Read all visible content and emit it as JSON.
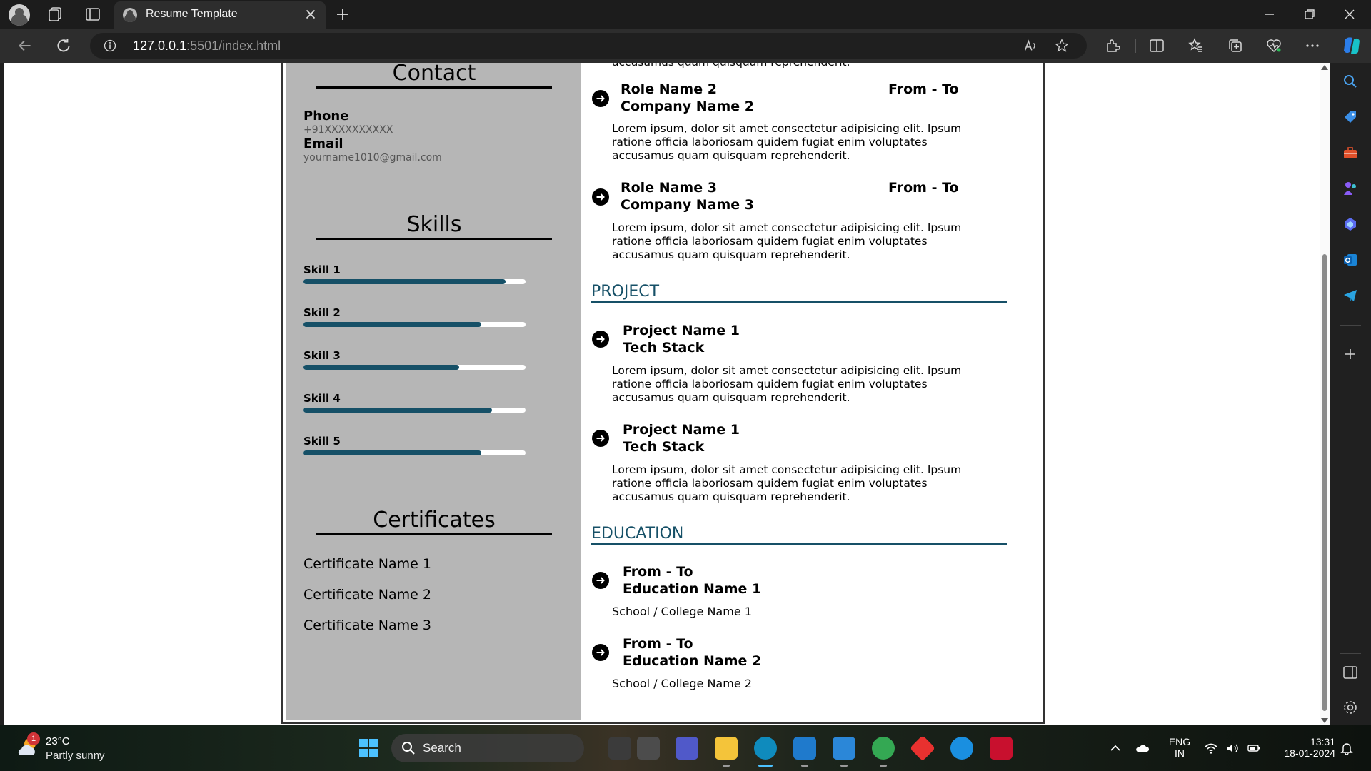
{
  "browser": {
    "tab_title": "Resume Template",
    "url_host": "127.0.0.1",
    "url_rest": ":5501/index.html"
  },
  "resume": {
    "truncated_text": "accusamus quam quisquam reprehenderit.",
    "contact": {
      "heading": "Contact",
      "phone_label": "Phone",
      "phone_value": "+91XXXXXXXXXX",
      "email_label": "Email",
      "email_value": "yourname1010@gmail.com"
    },
    "skills": {
      "heading": "Skills",
      "items": [
        {
          "name": "Skill 1",
          "level": 0.91
        },
        {
          "name": "Skill 2",
          "level": 0.8
        },
        {
          "name": "Skill 3",
          "level": 0.7
        },
        {
          "name": "Skill 4",
          "level": 0.85
        },
        {
          "name": "Skill 5",
          "level": 0.8
        }
      ]
    },
    "certificates": {
      "heading": "Certificates",
      "items": [
        "Certificate Name 1",
        "Certificate Name 2",
        "Certificate Name 3"
      ]
    },
    "experience": [
      {
        "role": "Role Name 2",
        "company": "Company Name 2",
        "period": "From - To",
        "description": "Lorem ipsum, dolor sit amet consectetur adipisicing elit. Ipsum ratione officia laboriosam quidem fugiat enim voluptates accusamus quam quisquam reprehenderit."
      },
      {
        "role": "Role Name 3",
        "company": "Company Name 3",
        "period": "From - To",
        "description": "Lorem ipsum, dolor sit amet consectetur adipisicing elit. Ipsum ratione officia laboriosam quidem fugiat enim voluptates accusamus quam quisquam reprehenderit."
      }
    ],
    "project": {
      "heading": "PROJECT",
      "items": [
        {
          "name": "Project Name 1",
          "stack": "Tech Stack",
          "description": "Lorem ipsum, dolor sit amet consectetur adipisicing elit. Ipsum ratione officia laboriosam quidem fugiat enim voluptates accusamus quam quisquam reprehenderit."
        },
        {
          "name": "Project Name 1",
          "stack": "Tech Stack",
          "description": "Lorem ipsum, dolor sit amet consectetur adipisicing elit. Ipsum ratione officia laboriosam quidem fugiat enim voluptates accusamus quam quisquam reprehenderit."
        }
      ]
    },
    "education": {
      "heading": "EDUCATION",
      "items": [
        {
          "period": "From - To",
          "name": "Education Name 1",
          "school": "School / College Name 1"
        },
        {
          "period": "From - To",
          "name": "Education Name 2",
          "school": "School / College Name 2"
        }
      ]
    },
    "colors": {
      "accent": "#165067",
      "sidebar_bg": "#b6b6b6"
    }
  },
  "taskbar": {
    "weather_temp": "23°C",
    "weather_desc": "Partly sunny",
    "weather_badge": "1",
    "search_label": "Search",
    "lang_line1": "ENG",
    "lang_line2": "IN",
    "time": "13:31",
    "date": "18-01-2024"
  },
  "icons": {
    "titlebar": [
      "profile-avatar-icon",
      "workspaces-icon",
      "tab-actions-icon",
      "close-icon",
      "new-tab-icon",
      "minimize-icon",
      "restore-icon",
      "window-close-icon"
    ],
    "navbar": [
      "back-icon",
      "refresh-icon",
      "site-info-icon",
      "read-aloud-icon",
      "favorite-star-icon",
      "extensions-icon",
      "split-screen-icon",
      "favorites-icon",
      "collections-icon",
      "browser-essentials-icon",
      "more-icon",
      "copilot-icon"
    ],
    "edge_sidebar": [
      "search-icon",
      "shopping-icon",
      "tools-icon",
      "games-icon",
      "copilot-app-icon",
      "outlook-icon",
      "telegram-icon",
      "add-icon",
      "sidebar-toggle-icon",
      "settings-icon"
    ],
    "resume": [
      "arrow-circle-icon"
    ]
  }
}
